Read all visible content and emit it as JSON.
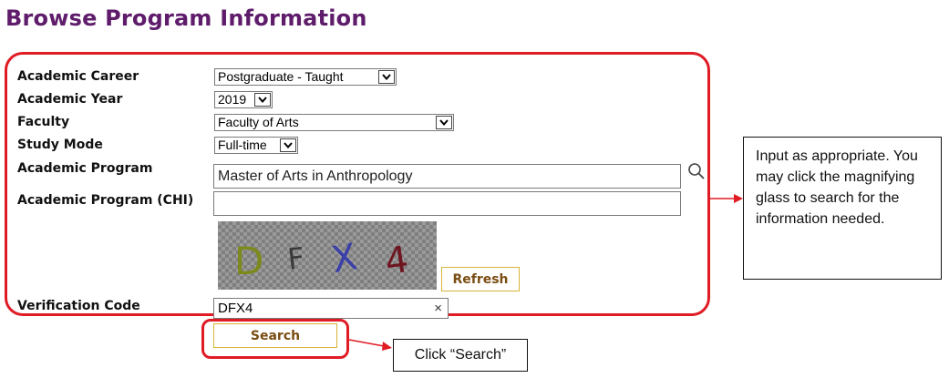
{
  "page_title": "Browse Program Information",
  "form": {
    "academic_career": {
      "label": "Academic Career",
      "value": "Postgraduate - Taught"
    },
    "academic_year": {
      "label": "Academic Year",
      "value": "2019"
    },
    "faculty": {
      "label": "Faculty",
      "value": "Faculty of Arts"
    },
    "study_mode": {
      "label": "Study Mode",
      "value": "Full-time"
    },
    "academic_program": {
      "label": "Academic Program",
      "value": "Master of Arts in Anthropology"
    },
    "academic_program_chi": {
      "label": "Academic Program (CHI)",
      "value": ""
    },
    "captcha": {
      "chars": [
        "D",
        "F",
        "X",
        "4"
      ],
      "refresh_label": "Refresh"
    },
    "verification_code": {
      "label": "Verification Code",
      "value": "DFX4",
      "clear_symbol": "×"
    },
    "search_label": "Search"
  },
  "annotations": {
    "main_note": "Input as appropriate. You may click the magnifying glass to search for the information needed.",
    "search_note": "Click “Search”",
    "highlight_color": "#e01b24"
  },
  "icons": {
    "dropdown": "chevron-down-icon",
    "search": "magnifier-icon",
    "clear": "close-icon"
  }
}
